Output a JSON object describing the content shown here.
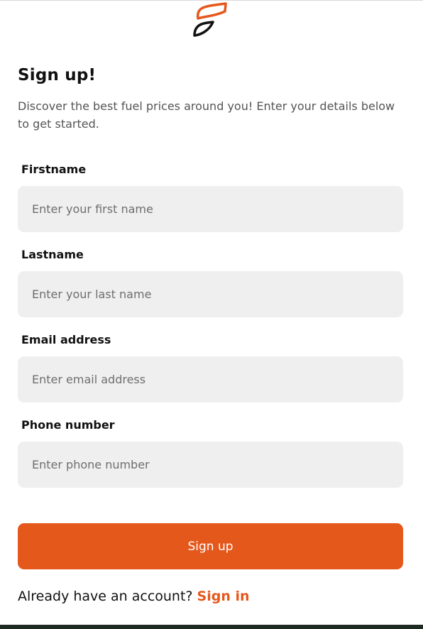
{
  "brand": {
    "logo_icon": "flame-leaf-logo-icon",
    "accent_color": "#e5581c",
    "dark_color": "#111111"
  },
  "header": {
    "title": "Sign up!",
    "subtitle": "Discover the best fuel prices around you! Enter your details below to get started."
  },
  "form": {
    "firstname": {
      "label": "Firstname",
      "placeholder": "Enter your first name",
      "value": ""
    },
    "lastname": {
      "label": "Lastname",
      "placeholder": "Enter your last name",
      "value": ""
    },
    "email": {
      "label": "Email address",
      "placeholder": "Enter email address",
      "value": ""
    },
    "phone": {
      "label": "Phone number",
      "placeholder": "Enter phone number",
      "value": ""
    },
    "submit_label": "Sign up"
  },
  "footer": {
    "prompt": "Already have an account?",
    "link_label": "Sign in"
  }
}
